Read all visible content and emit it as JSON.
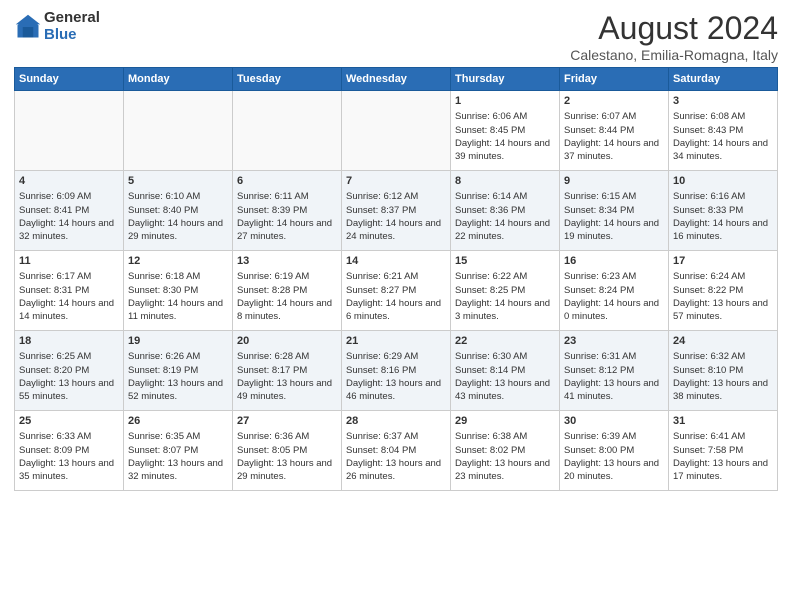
{
  "header": {
    "logo_general": "General",
    "logo_blue": "Blue",
    "title": "August 2024",
    "location": "Calestano, Emilia-Romagna, Italy"
  },
  "days_of_week": [
    "Sunday",
    "Monday",
    "Tuesday",
    "Wednesday",
    "Thursday",
    "Friday",
    "Saturday"
  ],
  "weeks": [
    {
      "days": [
        {
          "num": "",
          "info": ""
        },
        {
          "num": "",
          "info": ""
        },
        {
          "num": "",
          "info": ""
        },
        {
          "num": "",
          "info": ""
        },
        {
          "num": "1",
          "info": "Sunrise: 6:06 AM\nSunset: 8:45 PM\nDaylight: 14 hours and 39 minutes."
        },
        {
          "num": "2",
          "info": "Sunrise: 6:07 AM\nSunset: 8:44 PM\nDaylight: 14 hours and 37 minutes."
        },
        {
          "num": "3",
          "info": "Sunrise: 6:08 AM\nSunset: 8:43 PM\nDaylight: 14 hours and 34 minutes."
        }
      ]
    },
    {
      "days": [
        {
          "num": "4",
          "info": "Sunrise: 6:09 AM\nSunset: 8:41 PM\nDaylight: 14 hours and 32 minutes."
        },
        {
          "num": "5",
          "info": "Sunrise: 6:10 AM\nSunset: 8:40 PM\nDaylight: 14 hours and 29 minutes."
        },
        {
          "num": "6",
          "info": "Sunrise: 6:11 AM\nSunset: 8:39 PM\nDaylight: 14 hours and 27 minutes."
        },
        {
          "num": "7",
          "info": "Sunrise: 6:12 AM\nSunset: 8:37 PM\nDaylight: 14 hours and 24 minutes."
        },
        {
          "num": "8",
          "info": "Sunrise: 6:14 AM\nSunset: 8:36 PM\nDaylight: 14 hours and 22 minutes."
        },
        {
          "num": "9",
          "info": "Sunrise: 6:15 AM\nSunset: 8:34 PM\nDaylight: 14 hours and 19 minutes."
        },
        {
          "num": "10",
          "info": "Sunrise: 6:16 AM\nSunset: 8:33 PM\nDaylight: 14 hours and 16 minutes."
        }
      ]
    },
    {
      "days": [
        {
          "num": "11",
          "info": "Sunrise: 6:17 AM\nSunset: 8:31 PM\nDaylight: 14 hours and 14 minutes."
        },
        {
          "num": "12",
          "info": "Sunrise: 6:18 AM\nSunset: 8:30 PM\nDaylight: 14 hours and 11 minutes."
        },
        {
          "num": "13",
          "info": "Sunrise: 6:19 AM\nSunset: 8:28 PM\nDaylight: 14 hours and 8 minutes."
        },
        {
          "num": "14",
          "info": "Sunrise: 6:21 AM\nSunset: 8:27 PM\nDaylight: 14 hours and 6 minutes."
        },
        {
          "num": "15",
          "info": "Sunrise: 6:22 AM\nSunset: 8:25 PM\nDaylight: 14 hours and 3 minutes."
        },
        {
          "num": "16",
          "info": "Sunrise: 6:23 AM\nSunset: 8:24 PM\nDaylight: 14 hours and 0 minutes."
        },
        {
          "num": "17",
          "info": "Sunrise: 6:24 AM\nSunset: 8:22 PM\nDaylight: 13 hours and 57 minutes."
        }
      ]
    },
    {
      "days": [
        {
          "num": "18",
          "info": "Sunrise: 6:25 AM\nSunset: 8:20 PM\nDaylight: 13 hours and 55 minutes."
        },
        {
          "num": "19",
          "info": "Sunrise: 6:26 AM\nSunset: 8:19 PM\nDaylight: 13 hours and 52 minutes."
        },
        {
          "num": "20",
          "info": "Sunrise: 6:28 AM\nSunset: 8:17 PM\nDaylight: 13 hours and 49 minutes."
        },
        {
          "num": "21",
          "info": "Sunrise: 6:29 AM\nSunset: 8:16 PM\nDaylight: 13 hours and 46 minutes."
        },
        {
          "num": "22",
          "info": "Sunrise: 6:30 AM\nSunset: 8:14 PM\nDaylight: 13 hours and 43 minutes."
        },
        {
          "num": "23",
          "info": "Sunrise: 6:31 AM\nSunset: 8:12 PM\nDaylight: 13 hours and 41 minutes."
        },
        {
          "num": "24",
          "info": "Sunrise: 6:32 AM\nSunset: 8:10 PM\nDaylight: 13 hours and 38 minutes."
        }
      ]
    },
    {
      "days": [
        {
          "num": "25",
          "info": "Sunrise: 6:33 AM\nSunset: 8:09 PM\nDaylight: 13 hours and 35 minutes."
        },
        {
          "num": "26",
          "info": "Sunrise: 6:35 AM\nSunset: 8:07 PM\nDaylight: 13 hours and 32 minutes."
        },
        {
          "num": "27",
          "info": "Sunrise: 6:36 AM\nSunset: 8:05 PM\nDaylight: 13 hours and 29 minutes."
        },
        {
          "num": "28",
          "info": "Sunrise: 6:37 AM\nSunset: 8:04 PM\nDaylight: 13 hours and 26 minutes."
        },
        {
          "num": "29",
          "info": "Sunrise: 6:38 AM\nSunset: 8:02 PM\nDaylight: 13 hours and 23 minutes."
        },
        {
          "num": "30",
          "info": "Sunrise: 6:39 AM\nSunset: 8:00 PM\nDaylight: 13 hours and 20 minutes."
        },
        {
          "num": "31",
          "info": "Sunrise: 6:41 AM\nSunset: 7:58 PM\nDaylight: 13 hours and 17 minutes."
        }
      ]
    }
  ]
}
